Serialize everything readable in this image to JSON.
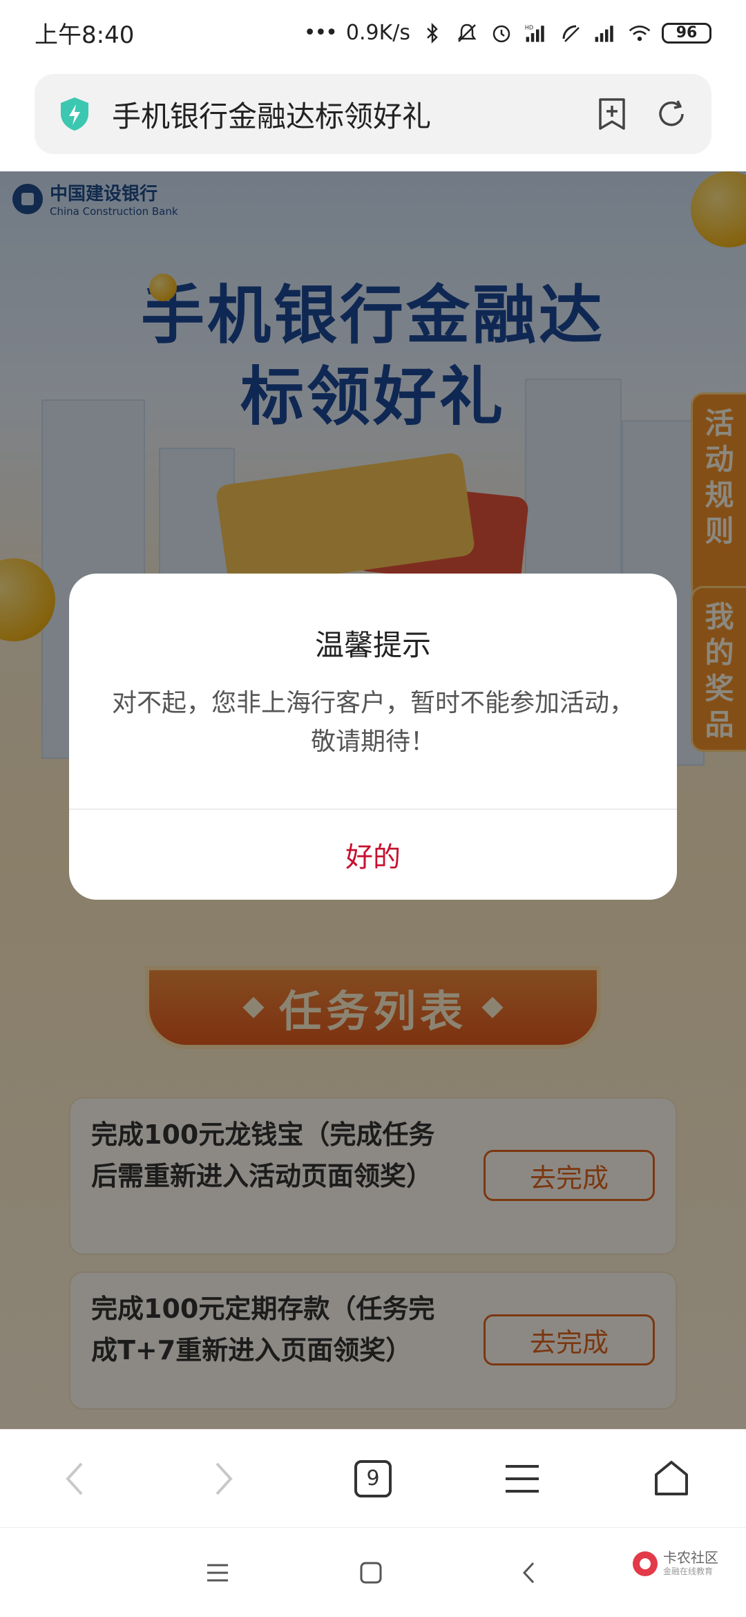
{
  "status_bar": {
    "time": "上午8:40",
    "network_speed": "0.9K/s",
    "battery": "96"
  },
  "address_bar": {
    "title": "手机银行金融达标领好礼"
  },
  "page": {
    "bank_name_cn": "中国建设银行",
    "bank_name_en": "China Construction Bank",
    "hero_title_line1": "手机银行金融达",
    "hero_title_line2": "标领好礼",
    "side_tab_rules": "活动规则",
    "side_tab_prizes": "我的奖品",
    "task_section_title": "任务列表",
    "tasks": [
      {
        "text": "完成100元龙钱宝（完成任务后需重新进入活动页面领奖）",
        "button": "去完成"
      },
      {
        "text": "完成100元定期存款（任务完成T+7重新进入页面领奖）",
        "button": "去完成"
      }
    ]
  },
  "dialog": {
    "title": "温馨提示",
    "message": "对不起，您非上海行客户，暂时不能参加活动，敬请期待！",
    "ok_button": "好的"
  },
  "toolbar": {
    "tab_count": "9"
  },
  "watermark": {
    "name": "卡农社区",
    "subtitle": "金融在线教育"
  },
  "colors": {
    "accent_red": "#c8102e",
    "hero_blue": "#1d4a98",
    "task_orange": "#e0641e"
  }
}
